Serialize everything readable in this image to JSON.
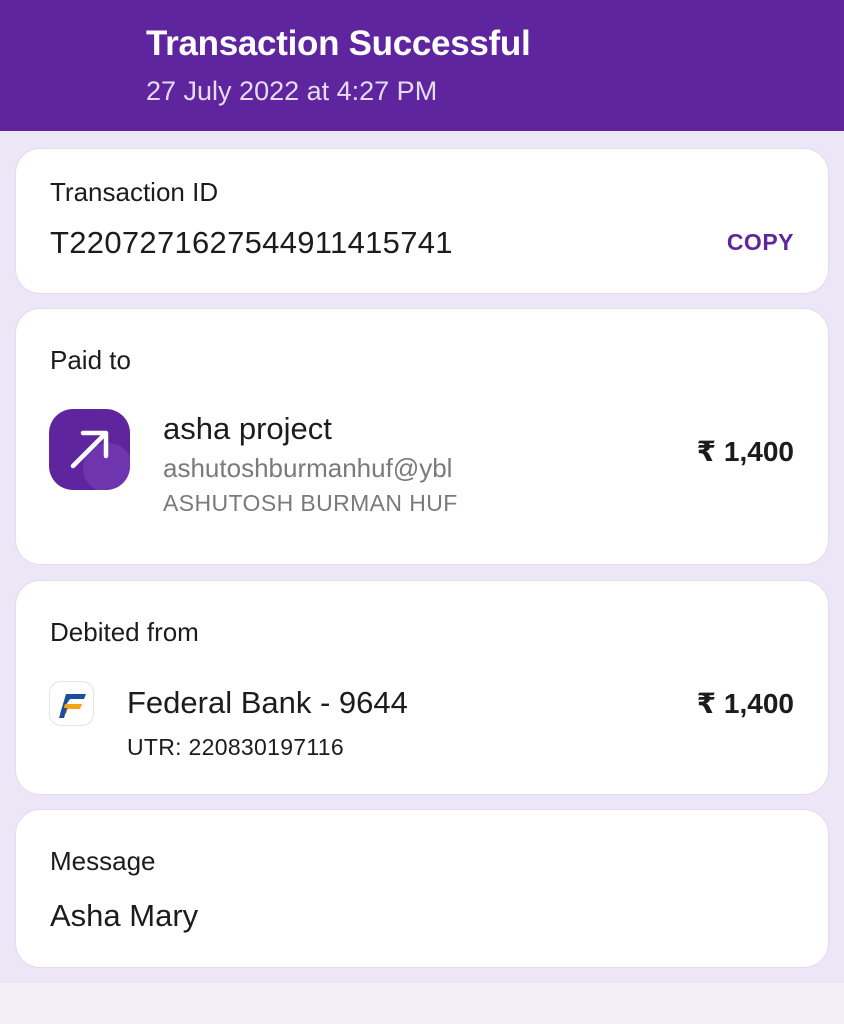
{
  "header": {
    "title": "Transaction Successful",
    "datetime": "27 July 2022 at 4:27 PM"
  },
  "transaction": {
    "label": "Transaction ID",
    "id": "T2207271627544911415741",
    "copy_label": "COPY"
  },
  "paid_to": {
    "label": "Paid to",
    "icon": "arrow-up-right-icon",
    "name": "asha project",
    "upi_id": "ashutoshburmanhuf@ybl",
    "legal_name": "ASHUTOSH BURMAN HUF",
    "amount": "₹ 1,400"
  },
  "debited_from": {
    "label": "Debited from",
    "icon": "federal-bank-logo",
    "bank": "Federal Bank - 9644",
    "utr": "UTR: 220830197116",
    "amount": "₹ 1,400"
  },
  "message": {
    "label": "Message",
    "text": "Asha Mary"
  },
  "colors": {
    "brand": "#5f259f",
    "background": "#ede6f6",
    "card": "#ffffff"
  }
}
